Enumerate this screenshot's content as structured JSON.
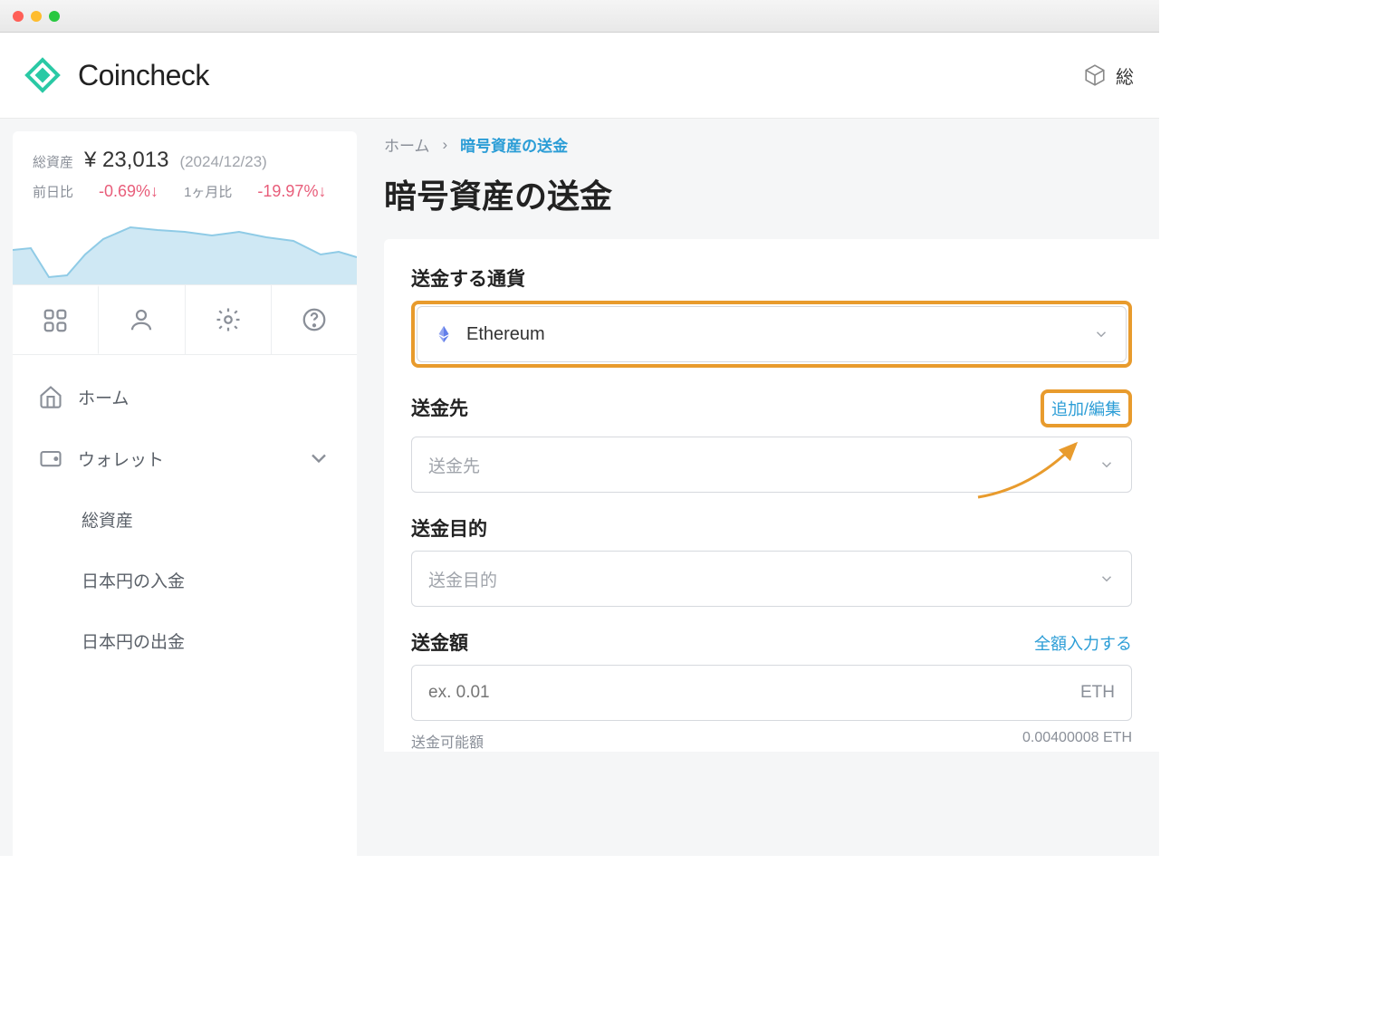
{
  "brand": {
    "name": "Coincheck"
  },
  "topbar_right": {
    "label": "総"
  },
  "sidebar": {
    "balance": {
      "label": "総資産",
      "amount": "¥ 23,013",
      "date": "(2024/12/23)",
      "day_label": "前日比",
      "day_change": "-0.69%↓",
      "month_label": "1ヶ月比",
      "month_change": "-19.97%↓"
    },
    "nav": {
      "home": "ホーム",
      "wallet": "ウォレット",
      "subs": [
        "総資産",
        "日本円の入金",
        "日本円の出金"
      ]
    }
  },
  "breadcrumb": {
    "home": "ホーム",
    "sep": "›",
    "current": "暗号資産の送金"
  },
  "page_title": "暗号資産の送金",
  "fields": {
    "currency": {
      "label": "送金する通貨",
      "value": "Ethereum"
    },
    "destination": {
      "label": "送金先",
      "action": "追加/編集",
      "placeholder": "送金先"
    },
    "purpose": {
      "label": "送金目的",
      "placeholder": "送金目的"
    },
    "amount": {
      "label": "送金額",
      "action": "全額入力する",
      "placeholder": "ex. 0.01",
      "unit": "ETH",
      "available_label": "送金可能額",
      "available_value": "0.00400008 ETH"
    }
  }
}
